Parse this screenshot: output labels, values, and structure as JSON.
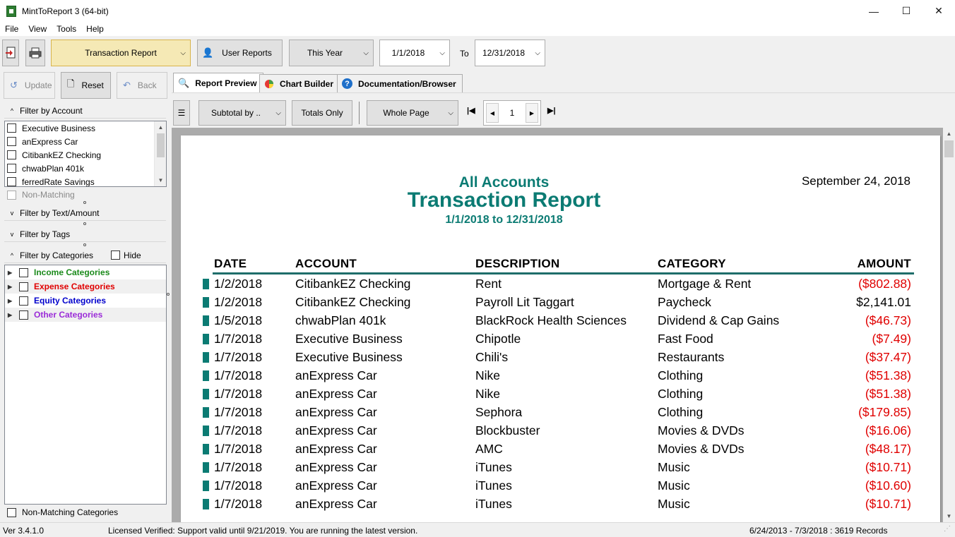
{
  "window": {
    "title": "MintToReport 3 (64-bit)",
    "minimize": "—",
    "maximize": "☐",
    "close": "✕"
  },
  "menu": [
    "File",
    "View",
    "Tools",
    "Help"
  ],
  "toolbar": {
    "report_select": "Transaction Report",
    "user_reports": "User Reports",
    "period_select": "This Year",
    "date_from": "1/1/2018",
    "to_label": "To",
    "date_to": "12/31/2018"
  },
  "left": {
    "update": "Update",
    "reset": "Reset",
    "back": "Back",
    "filter_account": "Filter by Account",
    "accounts": [
      "Executive Business",
      "anExpress Car",
      "CitibankEZ Checking",
      "chwabPlan 401k",
      "ferredRate Savings"
    ],
    "non_matching": "Non-Matching",
    "filter_text": "Filter by Text/Amount",
    "filter_tags": "Filter by Tags",
    "filter_categories": "Filter by Categories",
    "hide": "Hide",
    "categories": [
      {
        "label": "Income Categories",
        "color": "#1a8a1a"
      },
      {
        "label": "Expense Categories",
        "color": "#e00000"
      },
      {
        "label": "Equity Categories",
        "color": "#0000cc"
      },
      {
        "label": "Other Categories",
        "color": "#9a2bd8"
      }
    ],
    "non_matching_categories": "Non-Matching Categories"
  },
  "tabs": {
    "report_preview": "Report Preview",
    "chart_builder": "Chart Builder",
    "documentation": "Documentation/Browser"
  },
  "report_toolbar": {
    "subtotal": "Subtotal by ..",
    "totals_only": "Totals Only",
    "zoom": "Whole Page",
    "page": "1"
  },
  "report": {
    "accounts_title": "All Accounts",
    "title": "Transaction Report",
    "range": "1/1/2018 to 12/31/2018",
    "date": "September 24, 2018",
    "columns": {
      "date": "DATE",
      "account": "ACCOUNT",
      "description": "DESCRIPTION",
      "category": "CATEGORY",
      "amount": "AMOUNT"
    },
    "rows": [
      {
        "date": "1/2/2018",
        "account": "CitibankEZ Checking",
        "description": "Rent",
        "category": "Mortgage & Rent",
        "amount": "($802.88)",
        "neg": true
      },
      {
        "date": "1/2/2018",
        "account": "CitibankEZ Checking",
        "description": "Payroll Lit Taggart",
        "category": "Paycheck",
        "amount": "$2,141.01",
        "neg": false
      },
      {
        "date": "1/5/2018",
        "account": "chwabPlan 401k",
        "description": "BlackRock Health Sciences",
        "category": "Dividend & Cap Gains",
        "amount": "($46.73)",
        "neg": true
      },
      {
        "date": "1/7/2018",
        "account": "Executive Business",
        "description": "Chipotle",
        "category": "Fast Food",
        "amount": "($7.49)",
        "neg": true
      },
      {
        "date": "1/7/2018",
        "account": "Executive Business",
        "description": "Chili's",
        "category": "Restaurants",
        "amount": "($37.47)",
        "neg": true
      },
      {
        "date": "1/7/2018",
        "account": "anExpress Car",
        "description": "Nike",
        "category": "Clothing",
        "amount": "($51.38)",
        "neg": true
      },
      {
        "date": "1/7/2018",
        "account": "anExpress Car",
        "description": "Nike",
        "category": "Clothing",
        "amount": "($51.38)",
        "neg": true
      },
      {
        "date": "1/7/2018",
        "account": "anExpress Car",
        "description": "Sephora",
        "category": "Clothing",
        "amount": "($179.85)",
        "neg": true
      },
      {
        "date": "1/7/2018",
        "account": "anExpress Car",
        "description": "Blockbuster",
        "category": "Movies & DVDs",
        "amount": "($16.06)",
        "neg": true
      },
      {
        "date": "1/7/2018",
        "account": "anExpress Car",
        "description": "AMC",
        "category": "Movies & DVDs",
        "amount": "($48.17)",
        "neg": true
      },
      {
        "date": "1/7/2018",
        "account": "anExpress Car",
        "description": "iTunes",
        "category": "Music",
        "amount": "($10.71)",
        "neg": true
      },
      {
        "date": "1/7/2018",
        "account": "anExpress Car",
        "description": "iTunes",
        "category": "Music",
        "amount": "($10.60)",
        "neg": true
      },
      {
        "date": "1/7/2018",
        "account": "anExpress Car",
        "description": "iTunes",
        "category": "Music",
        "amount": "($10.71)",
        "neg": true
      }
    ]
  },
  "status": {
    "version": "Ver 3.4.1.0",
    "license": "Licensed Verified: Support valid until 9/21/2019. You are running the latest version.",
    "records": "6/24/2013 - 7/3/2018 : 3619 Records"
  }
}
